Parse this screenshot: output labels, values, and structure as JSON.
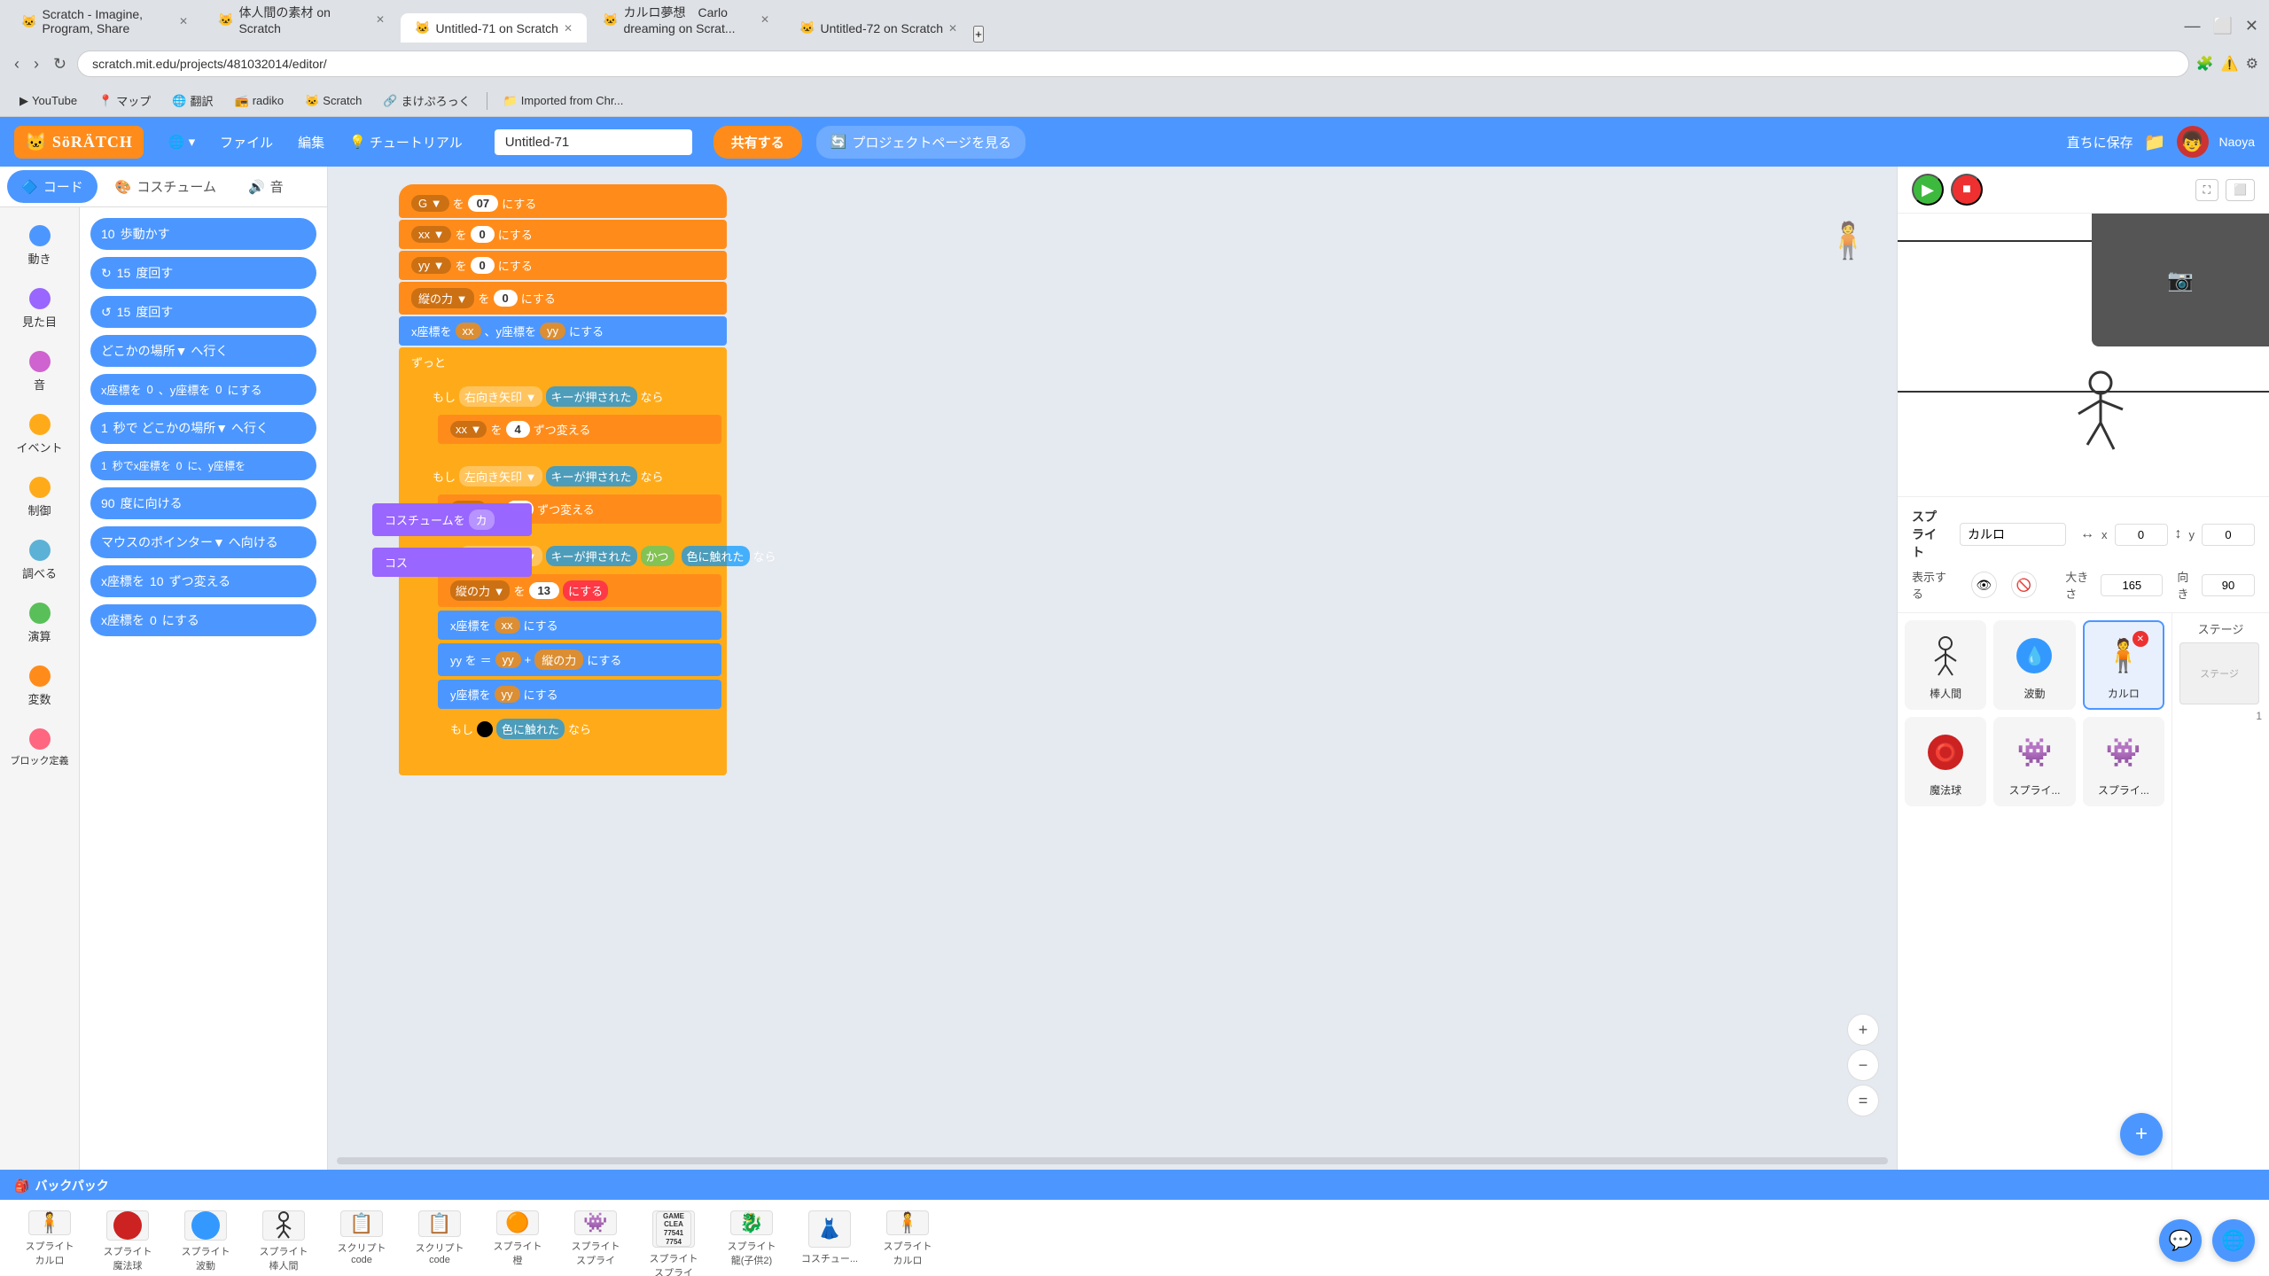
{
  "browser": {
    "tabs": [
      {
        "label": "Scratch - Imagine, Program, Share",
        "active": false,
        "favicon": "🐱"
      },
      {
        "label": "体人間の素材 on Scratch",
        "active": false,
        "favicon": "🐱"
      },
      {
        "label": "Untitled-71 on Scratch",
        "active": true,
        "favicon": "🐱"
      },
      {
        "label": "カルロ夢想　Carlo dreaming on Scrat...",
        "active": false,
        "favicon": "🐱"
      },
      {
        "label": "Untitled-72 on Scratch",
        "active": false,
        "favicon": "🐱"
      }
    ],
    "address": "scratch.mit.edu/projects/481032014/editor/",
    "bookmarks": [
      {
        "label": "YouTube",
        "icon": "▶"
      },
      {
        "label": "マップ",
        "icon": "📍"
      },
      {
        "label": "翻訳",
        "icon": "🌐"
      },
      {
        "label": "radiko",
        "icon": "📻"
      },
      {
        "label": "Scratch",
        "icon": "🐱"
      },
      {
        "label": "まけぷろっく",
        "icon": "🔗"
      },
      {
        "label": "Imported from Chr...",
        "icon": "📁"
      }
    ]
  },
  "scratch": {
    "logo": "SöRÄTCH",
    "nav": {
      "globe_label": "🌐",
      "file_label": "ファイル",
      "edit_label": "編集",
      "tutorial_label": "チュートリアル",
      "project_name": "Untitled-71",
      "share_label": "共有する",
      "project_page_label": "プロジェクトページを見る",
      "save_label": "直ちに保存",
      "user": "Naoya"
    },
    "editor_tabs": {
      "code": "コード",
      "costume": "コスチューム",
      "sound": "音"
    },
    "categories": [
      {
        "label": "動き",
        "color": "#4C97FF"
      },
      {
        "label": "見た目",
        "color": "#9966FF"
      },
      {
        "label": "音",
        "color": "#CF63CF"
      },
      {
        "label": "イベント",
        "color": "#FFAB19"
      },
      {
        "label": "制御",
        "color": "#FFAB19"
      },
      {
        "label": "調べる",
        "color": "#5CB1D6"
      },
      {
        "label": "演算",
        "color": "#59C059"
      },
      {
        "label": "変数",
        "color": "#FF8C1A"
      },
      {
        "label": "ブロック定義",
        "color": "#FF6680"
      }
    ],
    "blocks": [
      {
        "label": "10 歩動かす",
        "color": "blue"
      },
      {
        "label": "15 度回す ↻",
        "color": "blue"
      },
      {
        "label": "15 度回す ↺",
        "color": "blue"
      },
      {
        "label": "どこかの場所▼ へ行く",
        "color": "blue"
      },
      {
        "label": "x座標を 0 、y座標を 0 にする",
        "color": "blue"
      },
      {
        "label": "1 秒で どこかの場所▼ へ行く",
        "color": "blue"
      },
      {
        "label": "1 秒でx座標を 0 に、y座標を",
        "color": "blue"
      },
      {
        "label": "90 度に向ける",
        "color": "blue"
      },
      {
        "label": "マウスのポインター▼ へ向ける",
        "color": "blue"
      },
      {
        "label": "x座標を 10 ずつ変える",
        "color": "blue"
      },
      {
        "label": "x座標を 0 にする",
        "color": "blue"
      }
    ],
    "stage": {
      "sprite_name": "カルロ",
      "x": "0",
      "y": "0",
      "size": "165",
      "direction": "90",
      "show_label": "表示する",
      "size_label": "大きさ",
      "dir_label": "向き",
      "x_label": "x",
      "y_label": "y"
    },
    "sprites": [
      {
        "name": "棒人間",
        "icon": "🚶",
        "selected": false
      },
      {
        "name": "波動",
        "icon": "💙",
        "selected": false
      },
      {
        "name": "カルロ",
        "icon": "🧍",
        "selected": true
      },
      {
        "name": "魔法球",
        "icon": "🔴",
        "selected": false
      },
      {
        "name": "スプライ...",
        "icon": "👾",
        "selected": false
      },
      {
        "name": "スプライ...",
        "icon": "👾",
        "selected": false
      }
    ],
    "stage_section": {
      "label": "ステージ",
      "time": "1"
    },
    "backpack": {
      "label": "バックパック",
      "items": [
        {
          "label": "スプライト\nカルロ",
          "icon": "🧍"
        },
        {
          "label": "スプライト\n魔法球",
          "icon": "🔴"
        },
        {
          "label": "スプライト\n波動",
          "icon": "💙"
        },
        {
          "label": "スプライト\n棒人間",
          "icon": "🚶"
        },
        {
          "label": "スクリプト\ncode",
          "icon": "📋"
        },
        {
          "label": "スクリプト\ncode",
          "icon": "📋"
        },
        {
          "label": "スプライト\n橙",
          "icon": "🟠"
        },
        {
          "label": "スプライト\nスプライ",
          "icon": "👾"
        },
        {
          "label": "GAME\nCLEA",
          "icon": "🎮"
        },
        {
          "label": "スプライト\nスプライ",
          "icon": "👾"
        },
        {
          "label": "スプライト\n龍(子供2)",
          "icon": "🐉"
        },
        {
          "label": "コスチュー...",
          "icon": "👗"
        },
        {
          "label": "スプライト\nカルロ",
          "icon": "🧍"
        }
      ]
    }
  }
}
